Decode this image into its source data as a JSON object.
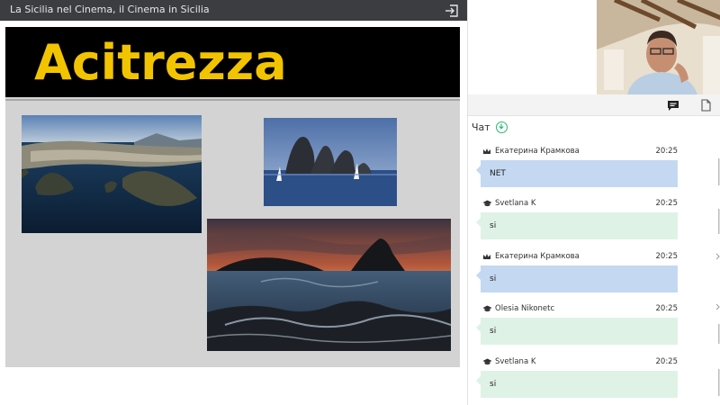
{
  "window": {
    "title": "La Sicilia nel Cinema, il Cinema in Sicilia"
  },
  "slide": {
    "title": "Acitrezza",
    "colors": {
      "title": "#f2c400",
      "header_bg": "#000000",
      "body_bg": "#d3d3d3"
    }
  },
  "panel": {
    "chat_tab_icon": "chat-icon",
    "files_tab_icon": "file-icon"
  },
  "chat": {
    "title": "Чат",
    "download_icon": "download-icon",
    "messages": [
      {
        "role": "moderator",
        "author": "Екатерина Крамкова",
        "time": "20:25",
        "text": "NET",
        "color": "#c4d8f1"
      },
      {
        "role": "student",
        "author": "Svetlana K",
        "time": "20:25",
        "text": "si",
        "color": "#dff2e6"
      },
      {
        "role": "moderator",
        "author": "Екатерина Крамкова",
        "time": "20:25",
        "text": "si",
        "color": "#c4d8f1"
      },
      {
        "role": "student",
        "author": "Olesia Nikonetc",
        "time": "20:25",
        "text": "si",
        "color": "#dff2e6"
      },
      {
        "role": "student",
        "author": "Svetlana K",
        "time": "20:25",
        "text": "si",
        "color": "#dff2e6"
      }
    ]
  }
}
